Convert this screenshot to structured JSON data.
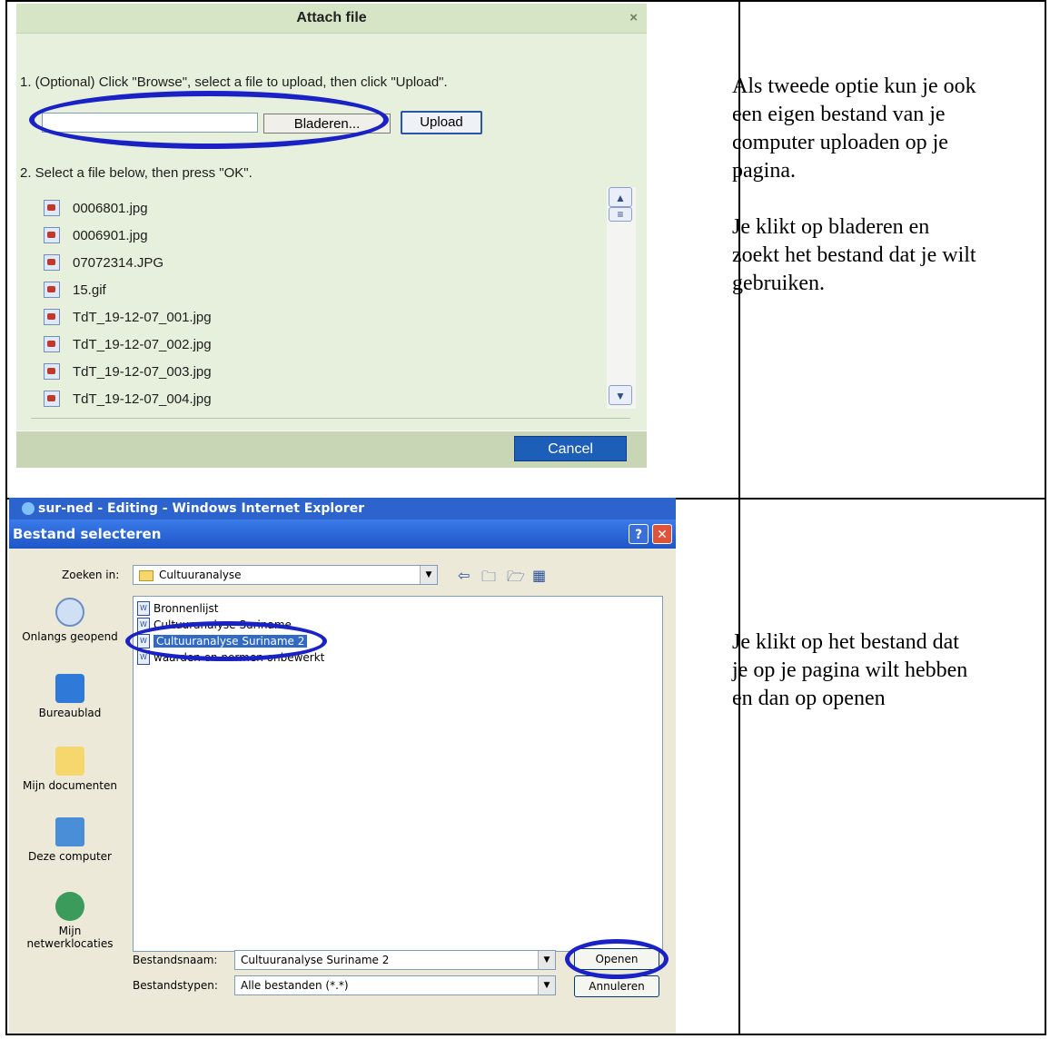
{
  "attach": {
    "title": "Attach file",
    "close": "×",
    "step1": "1. (Optional) Click \"Browse\", select a file to upload, then click \"Upload\".",
    "browse_label": "Bladeren...",
    "upload_label": "Upload",
    "step2": "2. Select a file below, then press \"OK\".",
    "files": [
      "0006801.jpg",
      "0006901.jpg",
      "07072314.JPG",
      "15.gif",
      "TdT_19-12-07_001.jpg",
      "TdT_19-12-07_002.jpg",
      "TdT_19-12-07_003.jpg",
      "TdT_19-12-07_004.jpg"
    ],
    "cancel_label": "Cancel"
  },
  "notes": {
    "top": [
      "Als tweede optie kun je ook",
      "een eigen bestand van je",
      "computer uploaden op je",
      "pagina.",
      "",
      "Je klikt op bladeren en",
      "zoekt het bestand dat je wilt",
      "gebruiken."
    ],
    "bottom": [
      "Je klikt op het bestand dat",
      "je op je pagina wilt hebben",
      "en dan op openen"
    ]
  },
  "dialog": {
    "ie_title": "sur-ned - Editing - Windows Internet Explorer",
    "title": "Bestand selecteren",
    "help": "?",
    "close": "✕",
    "zoeken_label": "Zoeken in:",
    "zoeken_value": "Cultuuranalyse",
    "places": [
      "Onlangs geopend",
      "Bureaublad",
      "Mijn documenten",
      "Deze computer",
      "Mijn netwerklocaties"
    ],
    "files": [
      "Bronnenlijst",
      "Cultuuranalyse Suriname",
      "Cultuuranalyse Suriname 2",
      "waarden en normen onbewerkt"
    ],
    "filename_label": "Bestandsnaam:",
    "filename_value": "Cultuuranalyse Suriname 2",
    "filetype_label": "Bestandstypen:",
    "filetype_value": "Alle bestanden (*.*)",
    "open_label": "Openen",
    "cancel_label": "Annuleren"
  },
  "colors": {
    "highlight_oval": "#1a22c6",
    "selection": "#316ac5"
  }
}
